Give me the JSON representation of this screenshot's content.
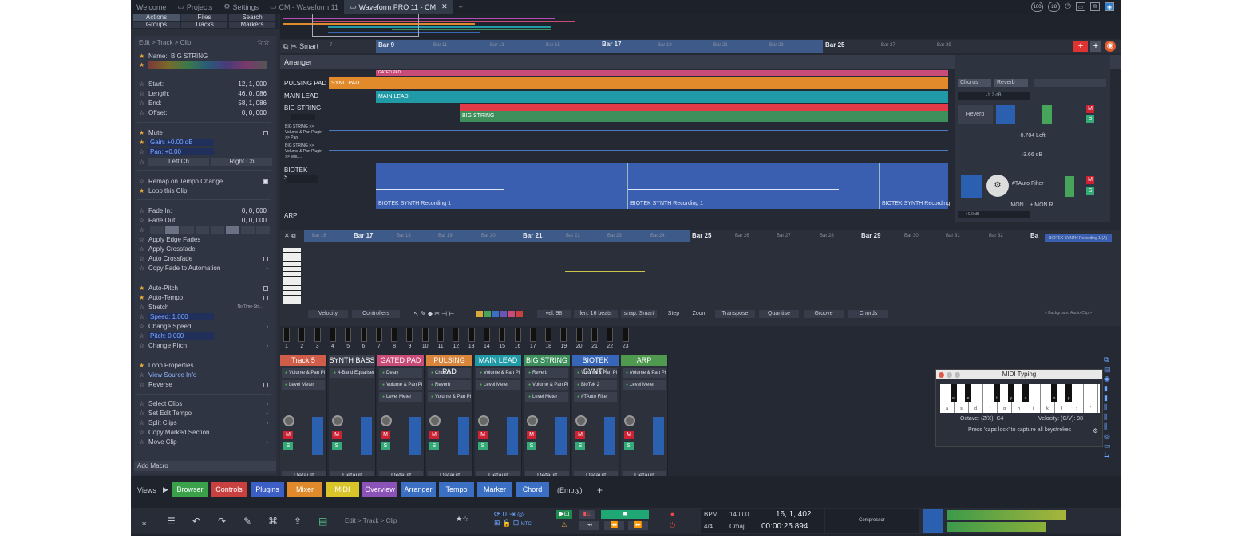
{
  "tabs": {
    "welcome": "Welcome",
    "projects": "Projects",
    "settings": "Settings",
    "cm": "CM - Waveform 11",
    "active": "Waveform PRO 11 - CM",
    "add": "+"
  },
  "indicators": {
    "a": "100",
    "b": "28"
  },
  "nav": {
    "actions": "Actions",
    "files": "Files",
    "search": "Search",
    "groups": "Groups",
    "tracks": "Tracks",
    "markers": "Markers"
  },
  "inspector": {
    "breadcrumb": "Edit > Track > Clip",
    "name_label": "Name:",
    "name_value": "BIG STRING",
    "start_label": "Start:",
    "start_value": "12, 1, 000",
    "length_label": "Length:",
    "length_value": "46, 0, 086",
    "end_label": "End:",
    "end_value": "58, 1, 086",
    "offset_label": "Offset:",
    "offset_value": "0, 0, 000",
    "mute": "Mute",
    "gain": "Gain: +0.00 dB",
    "pan": "Pan: +0.00",
    "left_ch": "Left Ch",
    "right_ch": "Right Ch",
    "remap": "Remap on Tempo Change",
    "loop_clip": "Loop this Clip",
    "fade_in_label": "Fade In:",
    "fade_in_value": "0, 0, 000",
    "fade_out_label": "Fade Out:",
    "fade_out_value": "0, 0, 000",
    "apply_edge": "Apply Edge Fades",
    "apply_cross": "Apply Crossfade",
    "auto_cross": "Auto Crossfade",
    "copy_fade": "Copy Fade to Automation",
    "auto_pitch": "Auto-Pitch",
    "auto_tempo": "Auto-Tempo",
    "stretch": "Stretch",
    "stretch_value": "No Time-Str...",
    "speed": "Speed: 1.000",
    "change_speed": "Change Speed",
    "pitch": "Pitch: 0.000",
    "change_pitch": "Change Pitch",
    "loop_props": "Loop Properties",
    "view_source": "View Source Info",
    "reverse": "Reverse",
    "select_clips": "Select Clips",
    "set_edit_tempo": "Set Edit Tempo",
    "split_clips": "Split Clips",
    "copy_marked": "Copy Marked Section",
    "move_clip": "Move Clip",
    "add_macro": "Add Macro"
  },
  "editor": {
    "smart": "Smart",
    "arranger": "Arranger",
    "ruler": [
      "Bar 9",
      "Bar 11",
      "Bar 13",
      "Bar 15",
      "Bar 17",
      "Bar 19",
      "Bar 21",
      "Bar 23",
      "Bar 25",
      "Bar 27",
      "Bar 29"
    ],
    "ruler_first": "7",
    "tracks": {
      "pulsing_pad": "PULSING PAD",
      "main_lead": "MAIN LEAD",
      "big_string": "BIG STRING",
      "vol_pan_1": "BIG STRING >> Volume & Pan Plugin >> Pan",
      "vol_pan_2": "BIG STRING >> Volume & Pan Plugin >> Volu...",
      "biotek": "BIOTEK SYNTH",
      "arp": "ARP",
      "gated_partial": "GATED PAD"
    },
    "clips": {
      "sync_pad": "SYNC PAD",
      "main_lead": "MAIN LEAD",
      "big_string": "BIG STRING",
      "biotek_rec": "BIOTEK SYNTH Recording 1",
      "biotek_rec_b": "BIOTEK SYNTH Recording 1",
      "biotek_rec_c": "BIOTEK SYNTH Recording"
    },
    "right_panel": {
      "chorus": "Chorus",
      "reverb": "Reverb",
      "db1": "-1.2 dB",
      "reverb2": "Reverb",
      "left_val": "-0.704 Left",
      "db2": "-3.66 dB",
      "tauto": "#TAuto Filter",
      "mon": "MON L + MON R",
      "db3": "+0.0 dB"
    }
  },
  "piano_roll": {
    "ruler": [
      "Bar 16",
      "Bar 17",
      "Bar 18",
      "Bar 19",
      "Bar 20",
      "Bar 21",
      "Bar 22",
      "Bar 23",
      "Bar 24",
      "Bar 25",
      "Bar 26",
      "Bar 27",
      "Bar 28",
      "Bar 29",
      "Bar 30",
      "Bar 31",
      "Bar 32",
      "Ba"
    ],
    "clip_title": "BIOTEK SYNTH Recording 1 (A)",
    "bg_clip": "< Background Audio Clip >",
    "velocity": "Velocity",
    "controllers": "Controllers",
    "vel": "vel: 98",
    "len": "len: 16 beats",
    "snap": "snap: Smart",
    "step": "Step",
    "zoom": "Zoom",
    "transpose": "Transpose",
    "quantise": "Quantise",
    "groove": "Groove",
    "chords": "Chords"
  },
  "step_numbers": [
    "1",
    "2",
    "3",
    "4",
    "5",
    "6",
    "7",
    "8",
    "9",
    "10",
    "11",
    "12",
    "13",
    "14",
    "15",
    "16",
    "17",
    "18",
    "19",
    "20",
    "21",
    "22",
    "23"
  ],
  "mixer": [
    {
      "name": "Track 5",
      "color": "#d05c4a",
      "plugins": [
        "Volume & Pan Plugin",
        "Level Meter"
      ],
      "default": "Default"
    },
    {
      "name": "SYNTH BASS",
      "color": "#3a3f4b",
      "plugins": [
        "4-Band Equaliser"
      ],
      "default": "Default"
    },
    {
      "name": "GATED PAD",
      "color": "#c84b78",
      "plugins": [
        "Delay",
        "Volume & Pan Plugin",
        "Level Meter"
      ],
      "default": "Default"
    },
    {
      "name": "PULSING PAD",
      "color": "#d9853b",
      "plugins": [
        "Chorus",
        "Reverb",
        "Volume & Pan Plugin"
      ],
      "default": "Default"
    },
    {
      "name": "MAIN LEAD",
      "color": "#1f9aa6",
      "plugins": [
        "Volume & Pan Plugin",
        "Level Meter"
      ],
      "default": "Default"
    },
    {
      "name": "BIG STRING",
      "color": "#3d8f5b",
      "plugins": [
        "Reverb",
        "Volume & Pan Plugin",
        "Level Meter"
      ],
      "default": "Default"
    },
    {
      "name": "BIOTEK SYNTH",
      "color": "#3766b8",
      "plugins": [
        "Volume & Pan Plugin",
        "BioTek 2",
        "#TAuto Filter"
      ],
      "default": "Default"
    },
    {
      "name": "ARP",
      "color": "#4f9a4f",
      "plugins": [
        "Volume & Pan Plugin",
        "Level Meter"
      ],
      "default": "Default"
    }
  ],
  "midi_typing": {
    "title": "MIDI Typing",
    "octave": "Octave: (Z/X): C4",
    "velocity": "Velocity: (C/V): 98",
    "hint": "Press 'caps lock' to capture all keystrokes",
    "white_keys": [
      "a",
      "s",
      "d",
      "f",
      "g",
      "h",
      "j",
      "k",
      "l",
      ";",
      "'"
    ],
    "black_keys": [
      "w",
      "e",
      "t",
      "y",
      "u",
      "o",
      "p"
    ]
  },
  "views": {
    "label": "Views",
    "buttons": [
      {
        "label": "Browser",
        "color": "#3aa04a"
      },
      {
        "label": "Controls",
        "color": "#c8403f"
      },
      {
        "label": "Plugins",
        "color": "#3c5fc6"
      },
      {
        "label": "Mixer",
        "color": "#e08a2c"
      },
      {
        "label": "MIDI",
        "color": "#d9c42a"
      },
      {
        "label": "Overview",
        "color": "#8b52b8"
      },
      {
        "label": "Arranger",
        "color": "#3b6fc4"
      },
      {
        "label": "Tempo",
        "color": "#3b6fc4"
      },
      {
        "label": "Marker",
        "color": "#3b6fc4"
      },
      {
        "label": "Chord",
        "color": "#3b6fc4"
      }
    ],
    "empty": "(Empty)",
    "add": "+"
  },
  "transport": {
    "breadcrumb": "Edit > Track > Clip",
    "mtc": "MTC",
    "bpm_label": "BPM",
    "bpm_value": "140.00",
    "time_sig": "4/4",
    "key": "Cmaj",
    "position": "16, 1, 402",
    "time": "00:00:25.894",
    "compressor": "Compressor"
  }
}
